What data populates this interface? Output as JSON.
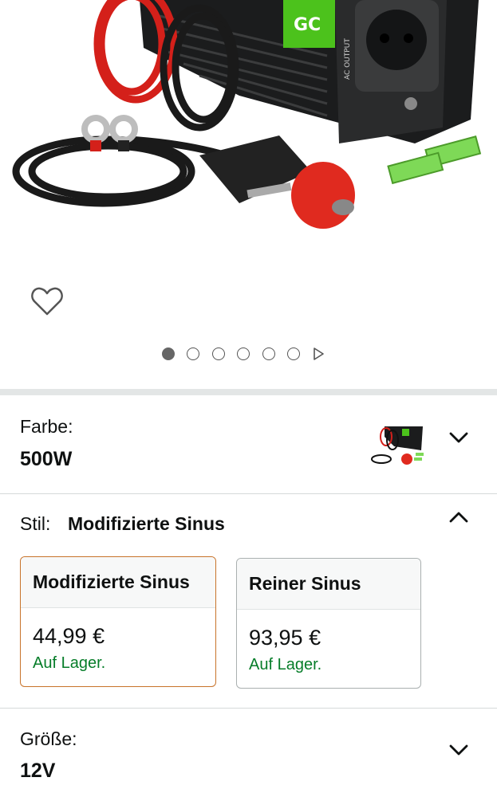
{
  "product_image": {
    "brand_mark": "GC",
    "output_label": "AC OUTPUT"
  },
  "gallery": {
    "wishlist_icon": "heart-outline-icon",
    "dot_count": 6,
    "active_index": 0,
    "next_icon": "play-triangle-icon"
  },
  "color_row": {
    "label": "Farbe:",
    "value": "500W",
    "thumbnail_icon": "product-thumbnail",
    "expand_icon": "chevron-down-icon"
  },
  "style_row": {
    "label": "Stil:",
    "value": "Modifizierte Sinus",
    "collapse_icon": "chevron-up-icon",
    "options": [
      {
        "name": "Modifizierte Sinus",
        "price": "44,99 €",
        "availability": "Auf Lager.",
        "selected": true
      },
      {
        "name": "Reiner Sinus",
        "price": "93,95 €",
        "availability": "Auf Lager.",
        "selected": false
      }
    ]
  },
  "size_row": {
    "label": "Größe:",
    "value": "12V",
    "expand_icon": "chevron-down-icon"
  },
  "colors": {
    "selected_border": "#c8732a",
    "in_stock": "#067d29",
    "accent_green": "#4cc21c",
    "cable_red": "#e02a1f"
  }
}
